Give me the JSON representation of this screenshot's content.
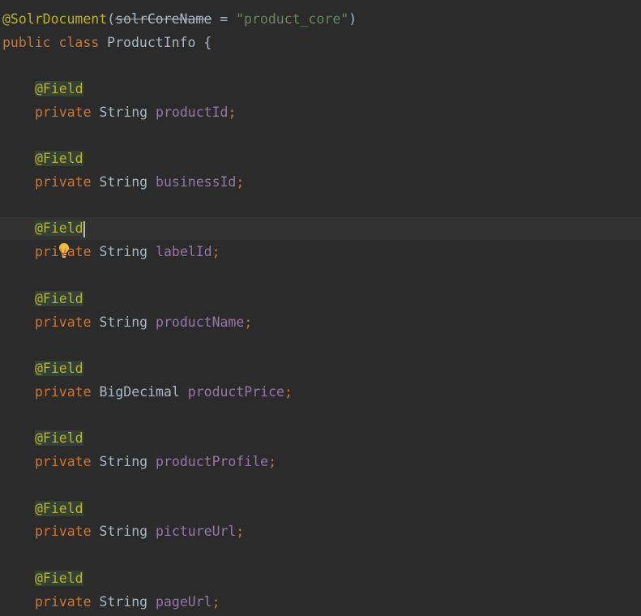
{
  "class_header": {
    "annotation": "@SolrDocument",
    "open_paren": "(",
    "attribute_name": "solrCoreName",
    "equals": " = ",
    "attribute_value": "\"product_core\"",
    "close_paren": ")",
    "keyword_public": "public",
    "keyword_class": "class",
    "class_name": "ProductInfo",
    "open_brace": "{"
  },
  "intention_icon": "lightbulb-icon",
  "colors": {
    "background": "#2b2b2b",
    "current_line": "#323232",
    "keyword": "#cc7832",
    "annotation": "#bbb529",
    "field": "#9876aa",
    "string": "#6a8759",
    "plain": "#a9b7c6",
    "bulb": "#f5b93b"
  },
  "fields": [
    {
      "annotation": "@Field",
      "modifier": "private",
      "type": "String",
      "name": "productId",
      "semicolon": ";"
    },
    {
      "annotation": "@Field",
      "modifier": "private",
      "type": "String",
      "name": "businessId",
      "semicolon": ";"
    },
    {
      "annotation": "@Field",
      "modifier": "private",
      "type": "String",
      "name": "labelId",
      "semicolon": ";"
    },
    {
      "annotation": "@Field",
      "modifier": "private",
      "type": "String",
      "name": "productName",
      "semicolon": ";"
    },
    {
      "annotation": "@Field",
      "modifier": "private",
      "type": "BigDecimal",
      "name": "productPrice",
      "semicolon": ";"
    },
    {
      "annotation": "@Field",
      "modifier": "private",
      "type": "String",
      "name": "productProfile",
      "semicolon": ";"
    },
    {
      "annotation": "@Field",
      "modifier": "private",
      "type": "String",
      "name": "pictureUrl",
      "semicolon": ";"
    },
    {
      "annotation": "@Field",
      "modifier": "private",
      "type": "String",
      "name": "pageUrl",
      "semicolon": ";"
    }
  ]
}
